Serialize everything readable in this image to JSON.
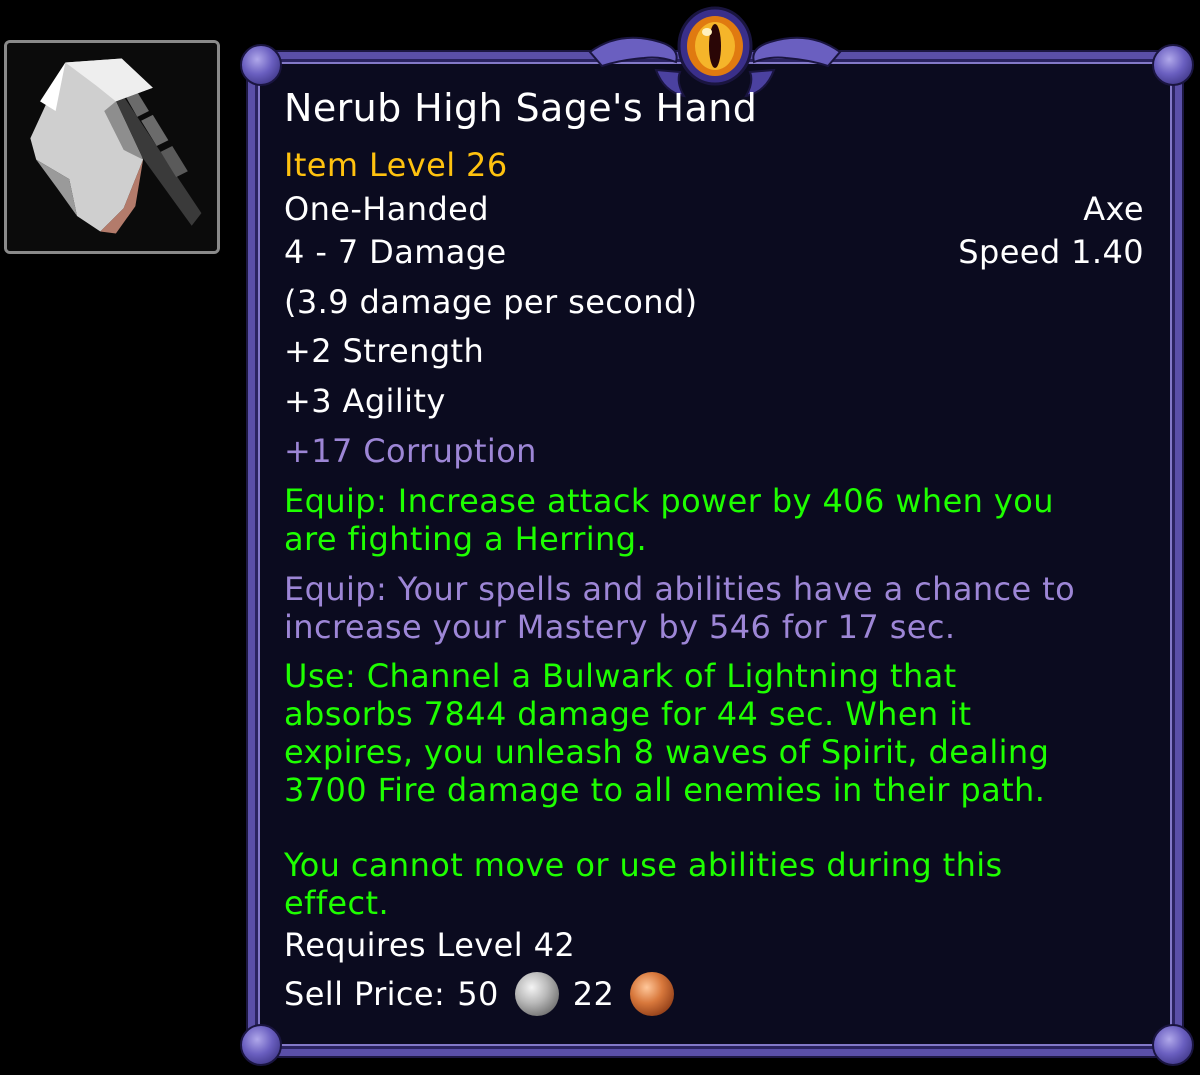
{
  "item": {
    "name": "Nerub High Sage's Hand",
    "item_level": "Item Level 26",
    "slot": "One-Handed",
    "type": "Axe",
    "damage": "4 - 7 Damage",
    "speed": "Speed 1.40",
    "dps": "(3.9 damage per second)",
    "stats": [
      "+2 Strength",
      "+3 Agility"
    ],
    "corruption": "+17 Corruption",
    "equip_effect_1": [
      "Equip: Increase attack power by 406 when you",
      "are fighting a Herring."
    ],
    "equip_effect_2": [
      "Equip: Your spells and abilities have a chance to",
      "increase your Mastery by 546 for 17 sec."
    ],
    "use_effect": [
      "Use: Channel a Bulwark of Lightning that",
      "absorbs 7844 damage for 44 sec. When it",
      "expires, you unleash 8 waves of Spirit, dealing",
      "3700 Fire damage to all enemies in their path."
    ],
    "use_effect_note": [
      "You cannot move or use abilities during this",
      "effect."
    ],
    "requires": "Requires Level 42",
    "sell_price_label": "Sell Price:",
    "sell_silver": "50",
    "sell_copper": "22"
  },
  "icons": {
    "item_icon": "axe-icon",
    "crest": "eye-crest-icon",
    "silver": "silver-coin-icon",
    "copper": "copper-coin-icon"
  },
  "colors": {
    "title": "#ffffff",
    "item_level": "#ffc20f",
    "effect_green": "#1eff00",
    "corruption_purple": "#9d86d6",
    "border": "#5a4fa8",
    "background": "#0b0b1f"
  }
}
